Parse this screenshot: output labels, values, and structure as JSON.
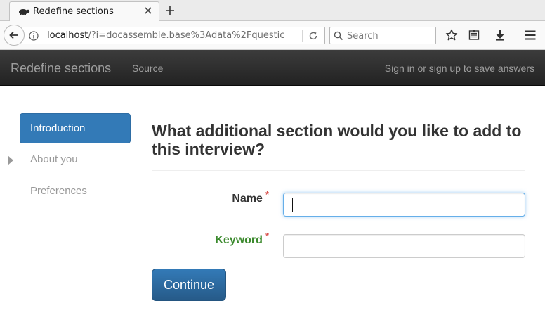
{
  "browser": {
    "tab_title": "Redefine sections",
    "url_host": "localhost",
    "url_rest": "/?i=docassemble.base%3Adata%2Fquestic",
    "search_placeholder": "Search"
  },
  "navbar": {
    "brand": "Redefine sections",
    "source_label": "Source",
    "signin_label": "Sign in or sign up to save answers"
  },
  "sidebar": {
    "items": [
      {
        "label": "Introduction",
        "active": true
      },
      {
        "label": "About you",
        "active": false
      },
      {
        "label": "Preferences",
        "active": false
      }
    ]
  },
  "form": {
    "question": "What additional section would you like to add to this interview?",
    "fields": [
      {
        "label": "Name",
        "required_mark": "*",
        "value": ""
      },
      {
        "label": "Keyword",
        "required_mark": "*",
        "value": ""
      }
    ],
    "continue_label": "Continue"
  },
  "colors": {
    "navbar_bg": "#222222",
    "active_item_bg": "#337ab7",
    "button_bg": "#265a88",
    "keyword_label": "#3c8a2e",
    "required_mark": "#d9534f"
  },
  "icons": {
    "tab_favicon": "turtle-icon",
    "tab_close": "close-icon",
    "new_tab": "plus-icon",
    "back": "back-arrow-icon",
    "info": "info-icon",
    "reload": "reload-icon",
    "search": "search-icon",
    "bookmark": "star-icon",
    "reader": "reader-list-icon",
    "download": "download-icon",
    "menu": "hamburger-menu-icon"
  }
}
